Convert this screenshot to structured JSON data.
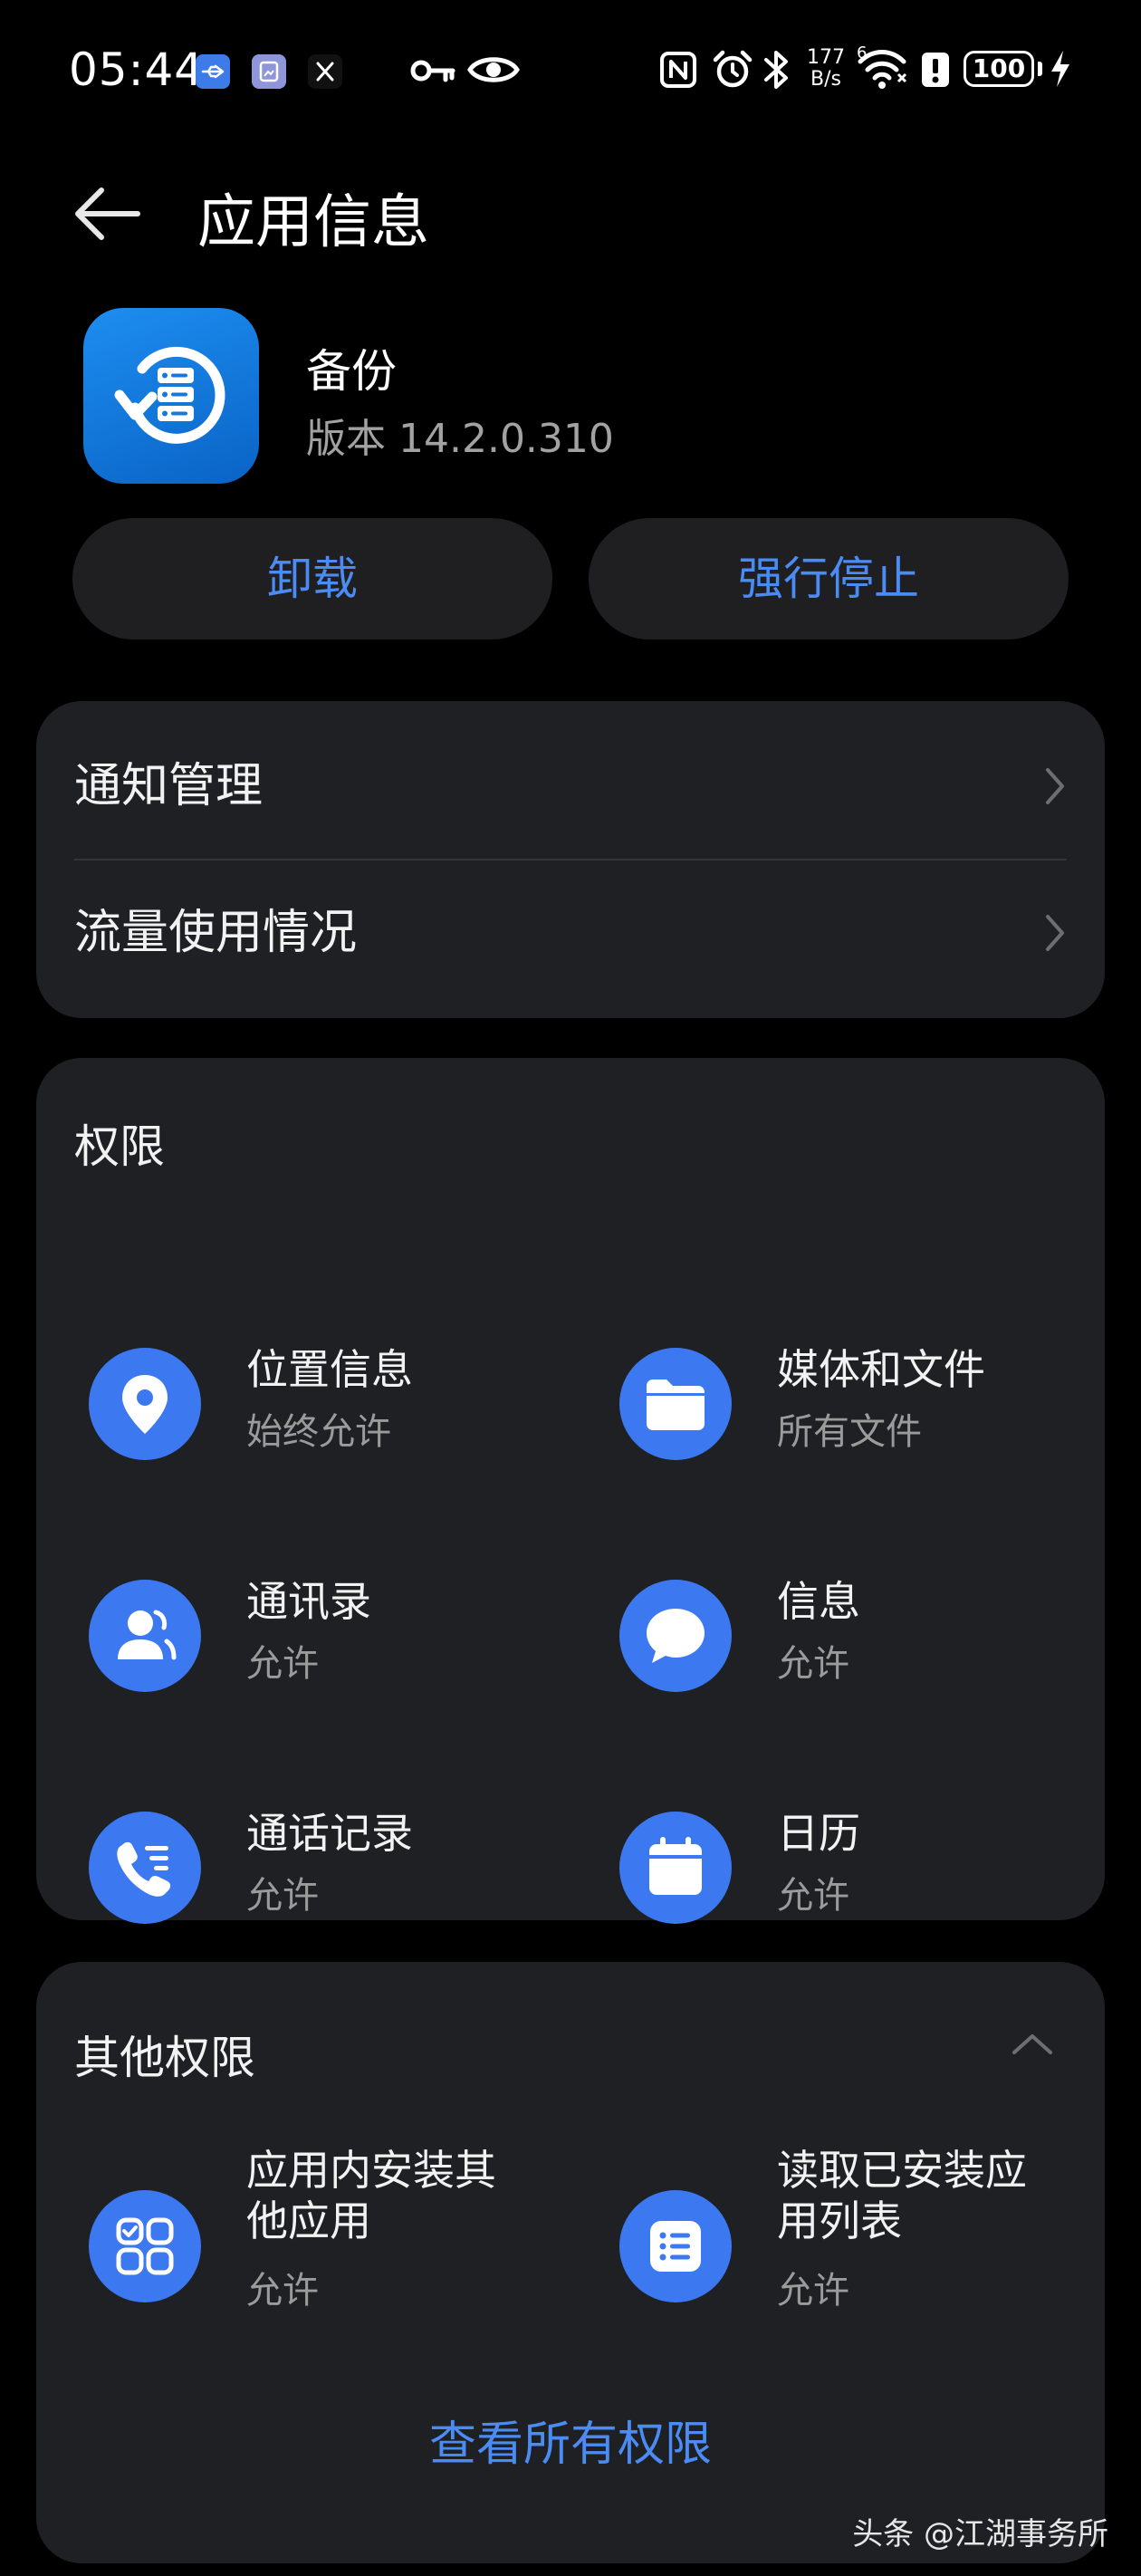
{
  "status_bar": {
    "time": "05:44",
    "network_speed_value": "177",
    "network_speed_unit": "B/s",
    "wifi_badge": "6",
    "battery": "100",
    "notification_icons": [
      "usb-icon",
      "gallery-app-icon",
      "x-app-icon"
    ],
    "indicator_icons": [
      "vpn-key-icon",
      "eye-comfort-icon",
      "nfc-icon",
      "alarm-icon",
      "bluetooth-icon",
      "wifi-icon",
      "alert-icon",
      "battery-icon",
      "charging-icon"
    ]
  },
  "header": {
    "title": "应用信息"
  },
  "app": {
    "name": "备份",
    "version": "版本 14.2.0.310",
    "icon": "backup-app-icon",
    "icon_color": "#1578de"
  },
  "actions": {
    "uninstall": "卸载",
    "force_stop": "强行停止"
  },
  "menu": {
    "items": [
      {
        "label": "通知管理"
      },
      {
        "label": "流量使用情况"
      }
    ]
  },
  "permissions": {
    "title": "权限",
    "items": [
      {
        "name": "位置信息",
        "status": "始终允许",
        "icon": "location-icon"
      },
      {
        "name": "媒体和文件",
        "status": "所有文件",
        "icon": "folder-icon"
      },
      {
        "name": "通讯录",
        "status": "允许",
        "icon": "contacts-icon"
      },
      {
        "name": "信息",
        "status": "允许",
        "icon": "message-icon"
      },
      {
        "name": "通话记录",
        "status": "允许",
        "icon": "call-log-icon"
      },
      {
        "name": "日历",
        "status": "允许",
        "icon": "calendar-icon"
      }
    ]
  },
  "other_permissions": {
    "title": "其他权限",
    "items": [
      {
        "name": "应用内安装其他应用",
        "status": "允许",
        "icon": "install-apps-icon"
      },
      {
        "name": "读取已安装应用列表",
        "status": "允许",
        "icon": "app-list-icon"
      }
    ],
    "view_all": "查看所有权限"
  },
  "watermark": "头条 @江湖事务所",
  "colors": {
    "background": "#000000",
    "card": "#1f2023",
    "accent": "#4a8cf3",
    "icon_circle": "#3c78f0",
    "secondary_text": "#9b9b9b"
  }
}
